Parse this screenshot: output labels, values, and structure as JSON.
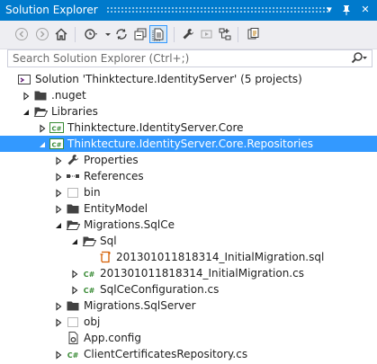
{
  "window": {
    "title": "Solution Explorer",
    "pin_glyph": "▾",
    "autohide_glyph": "⊥",
    "close_glyph": "✕"
  },
  "toolbar": {
    "buttons": [
      {
        "name": "back-icon"
      },
      {
        "name": "forward-icon"
      },
      {
        "name": "home-icon"
      },
      {
        "name": "pending-changes-icon"
      },
      {
        "name": "sync-icon"
      },
      {
        "name": "collapse-all-icon"
      },
      {
        "name": "show-all-files-icon",
        "active": true
      },
      {
        "name": "properties-icon"
      },
      {
        "name": "preview-icon"
      },
      {
        "name": "class-view-icon"
      },
      {
        "name": "copy-icon"
      }
    ]
  },
  "search": {
    "placeholder": "Search Solution Explorer (Ctrl+;)",
    "dropdown_glyph": "▾"
  },
  "tree": [
    {
      "label": "Solution 'Thinktecture.IdentityServer' (5 projects)",
      "level": 0,
      "icon": "solution-icon",
      "expander": "none"
    },
    {
      "label": ".nuget",
      "level": 1,
      "icon": "folder-icon",
      "expander": "collapsed"
    },
    {
      "label": "Libraries",
      "level": 1,
      "icon": "folder-open-icon",
      "expander": "expanded"
    },
    {
      "label": "Thinktecture.IdentityServer.Core",
      "level": 2,
      "icon": "csharp-project-icon",
      "expander": "collapsed"
    },
    {
      "label": "Thinktecture.IdentityServer.Core.Repositories",
      "level": 2,
      "icon": "csharp-project-icon",
      "expander": "expanded",
      "selected": true
    },
    {
      "label": "Properties",
      "level": 3,
      "icon": "wrench-icon",
      "expander": "collapsed"
    },
    {
      "label": "References",
      "level": 3,
      "icon": "references-icon",
      "expander": "collapsed"
    },
    {
      "label": "bin",
      "level": 3,
      "icon": "folder-dashed-icon",
      "expander": "collapsed"
    },
    {
      "label": "EntityModel",
      "level": 3,
      "icon": "folder-icon",
      "expander": "collapsed"
    },
    {
      "label": "Migrations.SqlCe",
      "level": 3,
      "icon": "folder-open-icon",
      "expander": "expanded"
    },
    {
      "label": "Sql",
      "level": 4,
      "icon": "folder-open-icon",
      "expander": "expanded"
    },
    {
      "label": "201301011818314_InitialMigration.sql",
      "level": 5,
      "icon": "sql-file-icon",
      "expander": "none"
    },
    {
      "label": "201301011818314_InitialMigration.cs",
      "level": 4,
      "icon": "csharp-file-icon",
      "expander": "collapsed"
    },
    {
      "label": "SqlCeConfiguration.cs",
      "level": 4,
      "icon": "csharp-file-icon",
      "expander": "collapsed"
    },
    {
      "label": "Migrations.SqlServer",
      "level": 3,
      "icon": "folder-icon",
      "expander": "collapsed"
    },
    {
      "label": "obj",
      "level": 3,
      "icon": "folder-dashed-icon",
      "expander": "collapsed"
    },
    {
      "label": "App.config",
      "level": 3,
      "icon": "config-file-icon",
      "expander": "none"
    },
    {
      "label": "ClientCertificatesRepository.cs",
      "level": 3,
      "icon": "csharp-file-icon",
      "expander": "collapsed"
    }
  ]
}
